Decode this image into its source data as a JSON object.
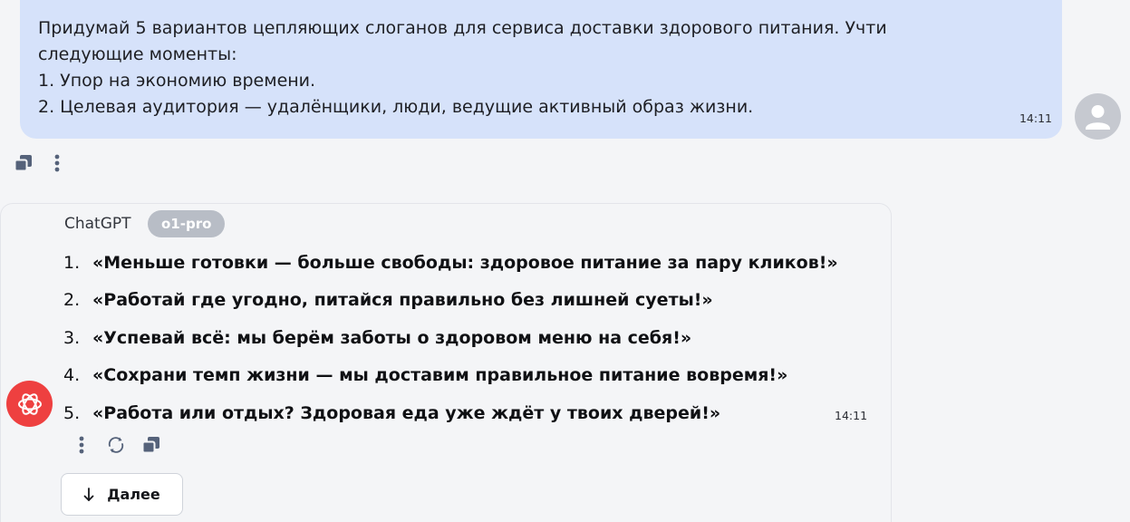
{
  "user_message": {
    "lines": [
      "Придумай 5 вариантов цепляющих слоганов для сервиса доставки здорового питания. Учти",
      "следующие моменты:",
      "1. Упор на экономию времени.",
      "2. Целевая аудитория — удалёнщики, люди, ведущие активный образ жизни."
    ],
    "time": "14:11",
    "avatar_icon": "user-icon",
    "actions": [
      {
        "icon": "copy-icon"
      },
      {
        "icon": "more-vertical-icon"
      }
    ]
  },
  "assistant_message": {
    "name": "ChatGPT",
    "model_badge": "o1-pro",
    "items": [
      {
        "num": "1.",
        "text": "«Меньше готовки — больше свободы: здоровое питание за пару кликов!»"
      },
      {
        "num": "2.",
        "text": "«Работай где угодно, питайся правильно без лишней суеты!»"
      },
      {
        "num": "3.",
        "text": "«Успевай всё: мы берём заботы о здоровом меню на себя!»"
      },
      {
        "num": "4.",
        "text": "«Сохрани темп жизни — мы доставим правильное питание вовремя!»"
      },
      {
        "num": "5.",
        "text": "«Работа или отдых? Здоровая еда уже ждёт у твоих дверей!»"
      }
    ],
    "time": "14:11",
    "logo_icon": "openai-logo-icon",
    "actions": [
      {
        "icon": "more-vertical-icon"
      },
      {
        "icon": "regenerate-icon"
      },
      {
        "icon": "copy-icon"
      }
    ]
  },
  "next_button": {
    "label": "Далее",
    "icon": "arrow-down-icon"
  },
  "colors": {
    "background": "#f4f5f7",
    "user_bubble": "#d6e2fa",
    "badge": "#b8bdc6",
    "logo": "#ee4040",
    "icon": "#55627a"
  }
}
